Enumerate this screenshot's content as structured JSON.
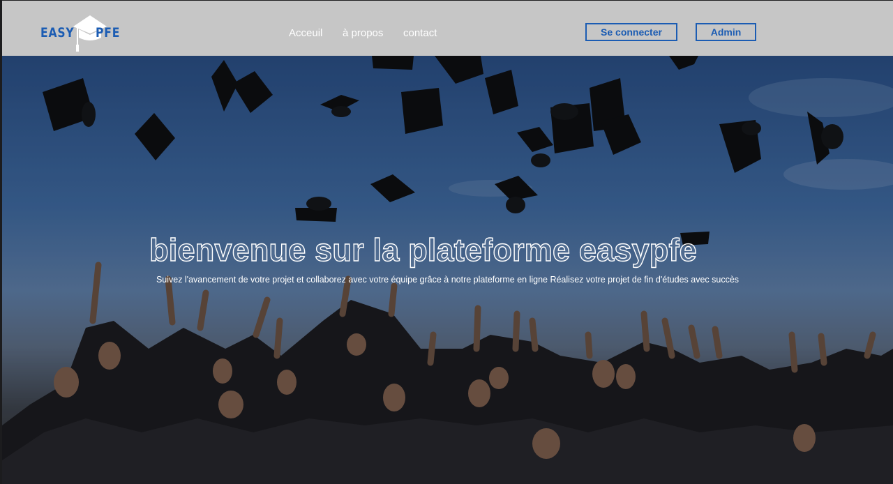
{
  "logo": {
    "left_text": "EASY",
    "right_text": "PFE",
    "hat_icon": "graduation-cap-icon"
  },
  "nav": {
    "links": [
      {
        "label": "Acceuil"
      },
      {
        "label": "à propos"
      },
      {
        "label": "contact"
      }
    ]
  },
  "actions": {
    "login_label": "Se connecter",
    "admin_label": "Admin"
  },
  "hero": {
    "title": "bienvenue sur la plateforme easypfe",
    "subtitle": "Suivez l'avancement de votre projet et collaborez avec votre équipe grâce à notre plateforme en ligne Réalisez votre projet de fin d'études avec succès",
    "background": "graduates-throwing-caps-photo"
  },
  "colors": {
    "navbar_bg": "#c6c6c6",
    "accent": "#1b5cb3",
    "nav_text": "#ffffff"
  }
}
